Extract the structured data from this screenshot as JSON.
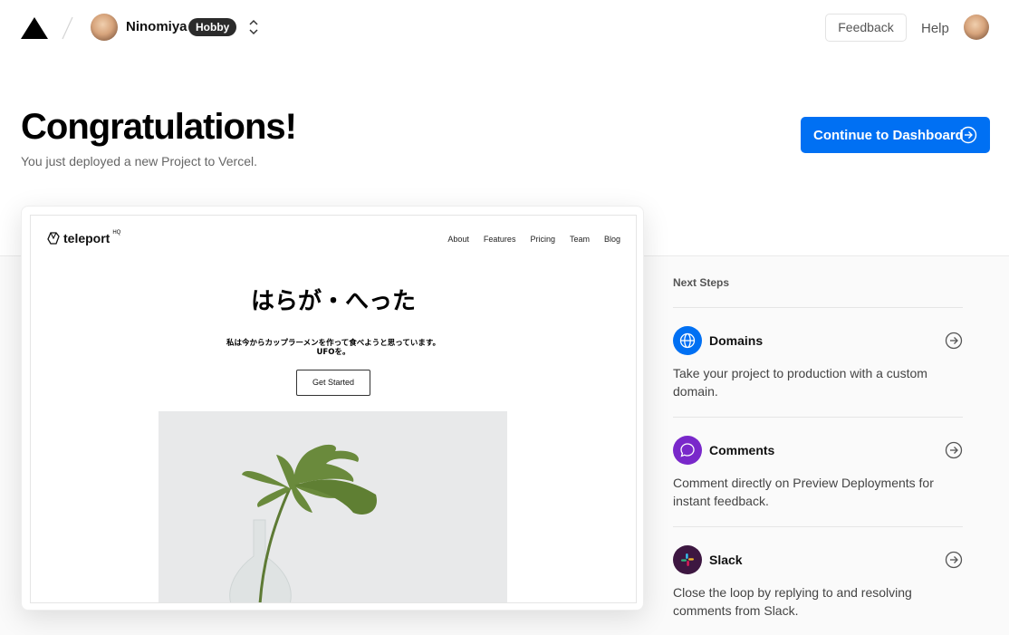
{
  "header": {
    "team_name": "Ninomiya",
    "plan_badge": "Hobby",
    "feedback_label": "Feedback",
    "help_label": "Help"
  },
  "hero": {
    "title": "Congratulations!",
    "subtitle": "You just deployed a new Project to Vercel.",
    "cta_label": "Continue to Dashboard"
  },
  "preview": {
    "logo_text": "teleport",
    "logo_sup": "HQ",
    "nav": [
      "About",
      "Features",
      "Pricing",
      "Team",
      "Blog"
    ],
    "heading": "はらが・へった",
    "body_line1": "私は今からカップラーメンを作って食べようと思っています。",
    "body_line2": "UFOを。",
    "button_label": "Get Started"
  },
  "next_steps": {
    "title": "Next Steps",
    "items": [
      {
        "name": "Domains",
        "description": "Take your project to production with a custom domain.",
        "icon": "globe-icon",
        "color": "#0070f3"
      },
      {
        "name": "Comments",
        "description": "Comment directly on Preview Deployments for instant feedback.",
        "icon": "comment-icon",
        "color": "#7928ca"
      },
      {
        "name": "Slack",
        "description": "Close the loop by replying to and resolving comments from Slack.",
        "icon": "slack-icon",
        "color": "#3d1741"
      }
    ]
  },
  "colors": {
    "accent": "#0070f3",
    "badge_bg": "#2b2b2b"
  }
}
